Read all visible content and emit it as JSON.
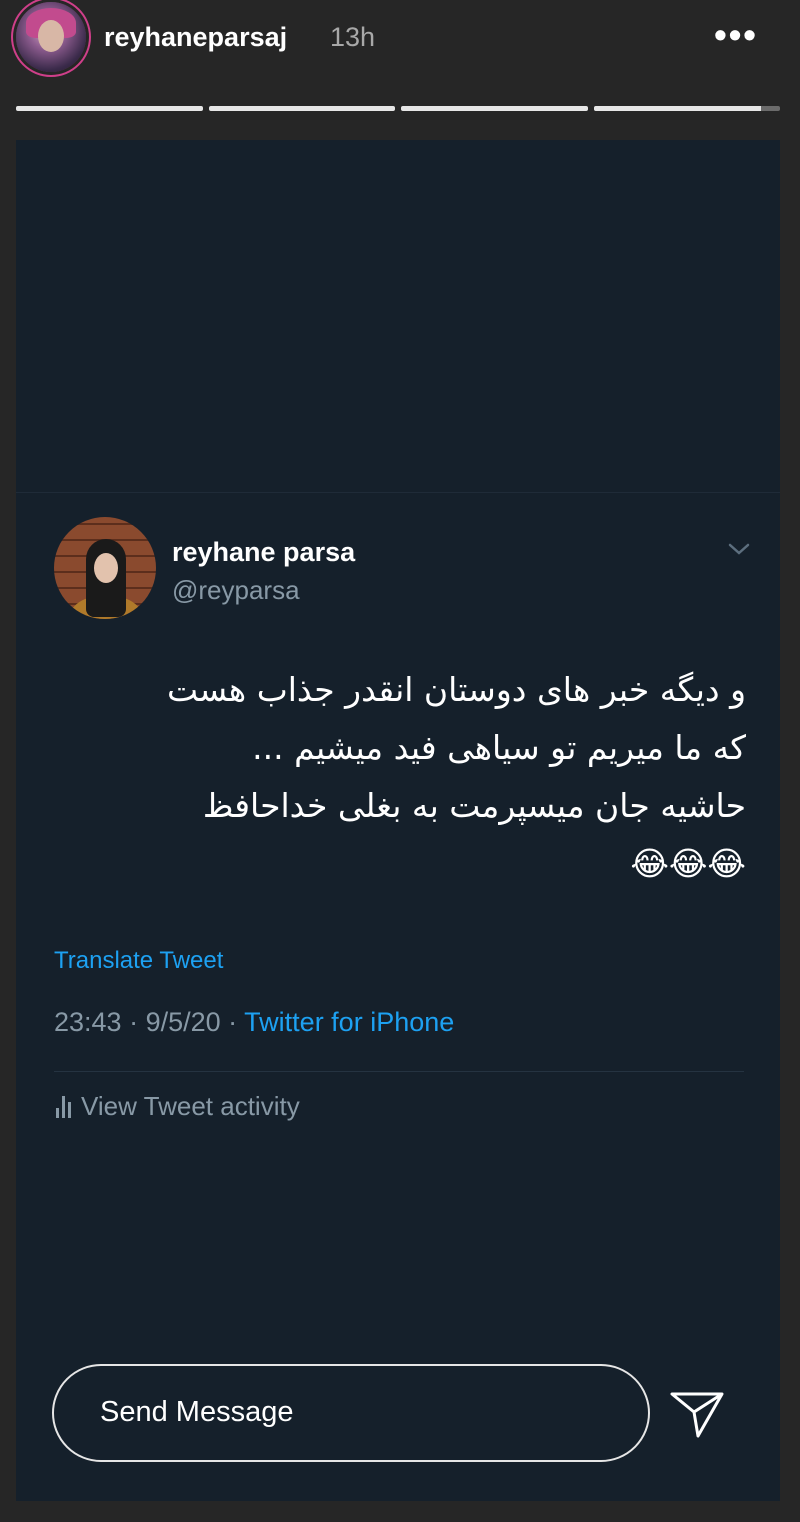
{
  "header": {
    "username": "reyhaneparsaj",
    "time_ago": "13h",
    "more_label": "•••",
    "progress": [
      1,
      1,
      1,
      0.9
    ]
  },
  "tweet": {
    "display_name": "reyhane parsa",
    "handle": "@reyparsa",
    "text_lines": [
      "و دیگه خبر های دوستان انقدر جذاب هست",
      "که ما میریم تو سیاهی فید میشیم ...",
      "حاشیه  جان میسپرمت به بغلی خداحافظ",
      "😂😂😂"
    ],
    "translate_label": "Translate Tweet",
    "time": "23:43",
    "date": "9/5/20",
    "separator": " · ",
    "source": "Twitter for iPhone",
    "activity_label": "View Tweet activity"
  },
  "footer": {
    "send_placeholder": "Send Message"
  },
  "colors": {
    "background": "#262626",
    "tweet_bg": "#15202b",
    "link": "#1da1f2",
    "muted": "#8899a6"
  }
}
